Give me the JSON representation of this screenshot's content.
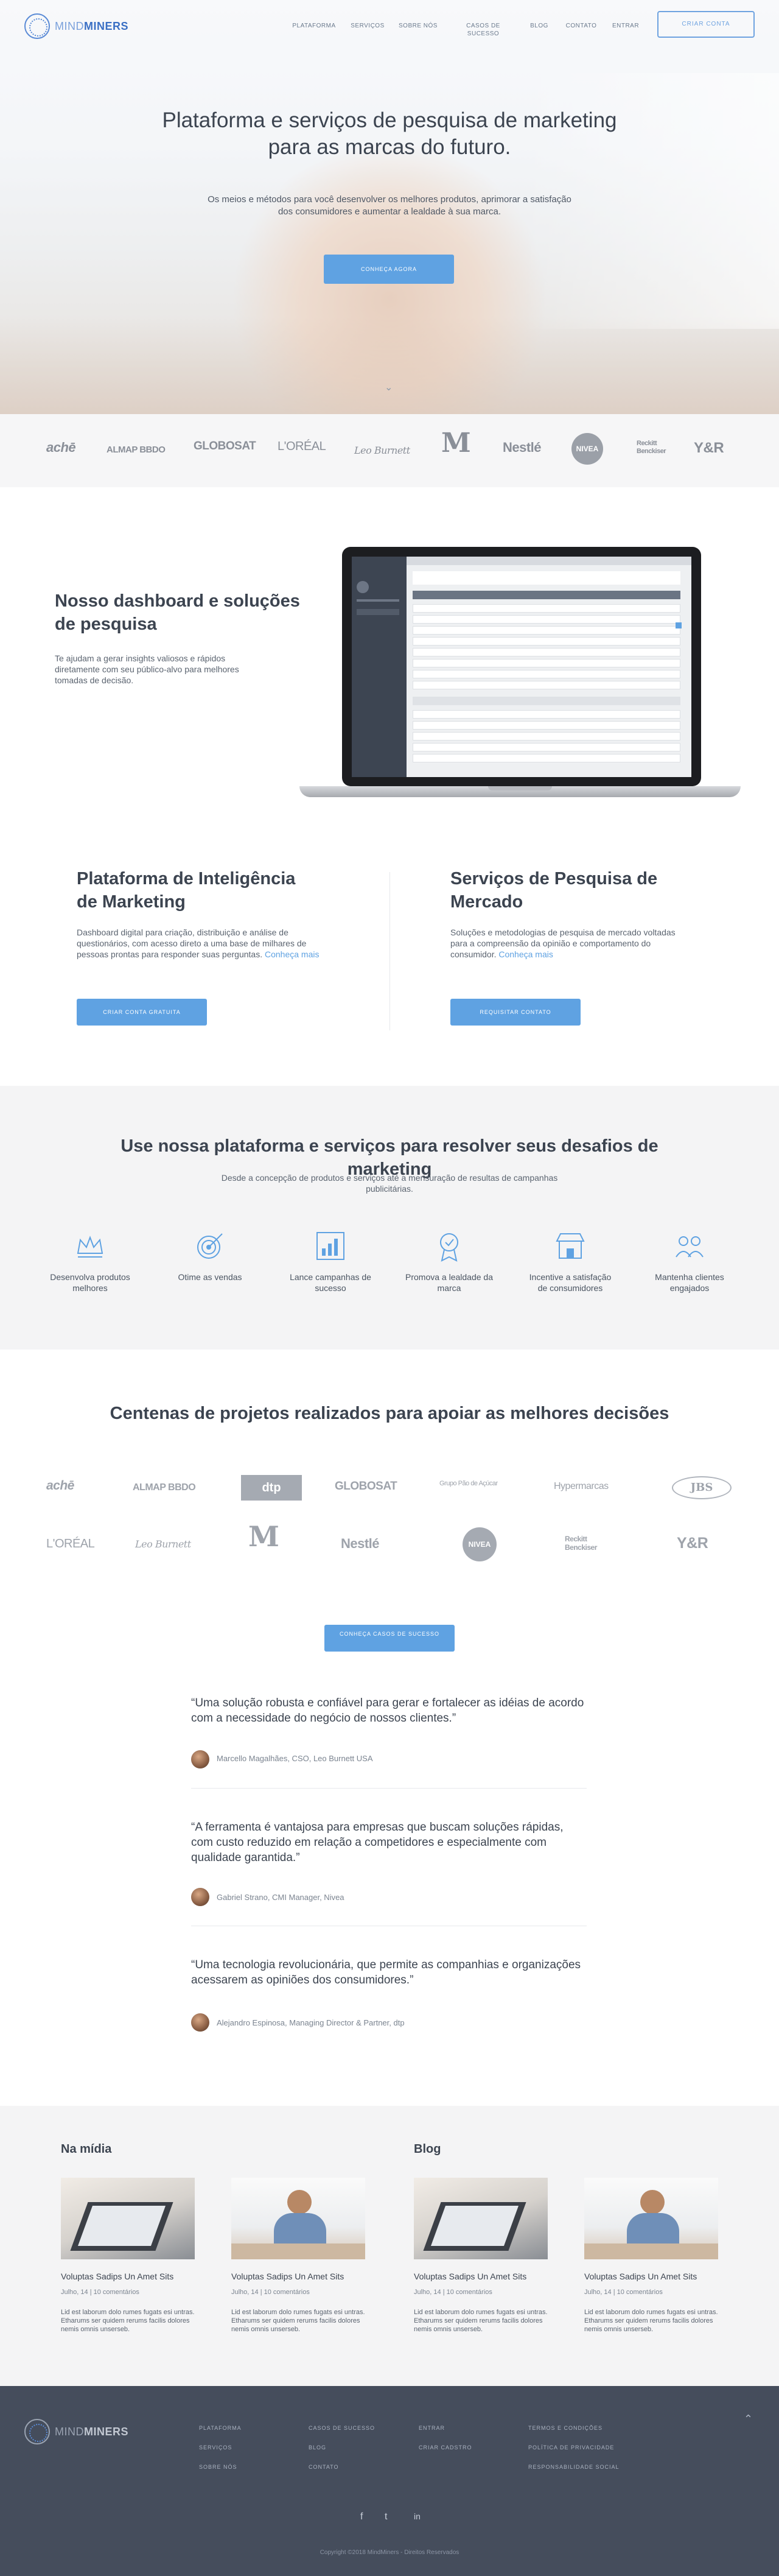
{
  "nav": {
    "logo_light": "MIND",
    "logo_bold": "MINERS",
    "items": [
      "PLATAFORMA",
      "SERVIÇOS",
      "SOBRE NÓS",
      "CASOS DE SUCESSO",
      "BLOG",
      "CONTATO",
      "ENTRAR"
    ],
    "cta": "CRIAR CONTA"
  },
  "hero": {
    "title": "Plataforma e serviços de pesquisa de marketing para as marcas do futuro.",
    "subtitle": "Os meios e métodos para você desenvolver os melhores produtos, aprimorar a satisfação dos consumidores e aumentar a lealdade à sua marca.",
    "button": "CONHEÇA AGORA"
  },
  "brands": [
    "achē",
    "ALMAP BBDO",
    "GLOBOSAT",
    "L'ORÉAL",
    "Leo Burnett",
    "M",
    "Nestlé",
    "NIVEA",
    "Reckitt Benckiser",
    "Y&R"
  ],
  "dashboard": {
    "title": "Nosso dashboard e soluções de pesquisa",
    "subtitle": "Te ajudam a gerar insights valiosos e rápidos diretamente com seu público-alvo para melhores tomadas de decisão."
  },
  "platform": {
    "title": "Plataforma de Inteligência de Marketing",
    "text": "Dashboard digital para criação, distribuição e análise de questionários, com acesso direto a uma base de milhares de pessoas prontas para responder suas perguntas.",
    "link": "Conheça mais",
    "button": "CRIAR CONTA GRATUITA"
  },
  "services": {
    "title": "Serviços de Pesquisa de Mercado",
    "text": "Soluções e metodologias de pesquisa de mercado voltadas para a compreensão da opinião e comportamento do consumidor.",
    "link": "Conheça mais",
    "button": "REQUISITAR CONTATO"
  },
  "features": {
    "title": "Use nossa plataforma e serviços para resolver seus desafios de marketing",
    "subtitle": "Desde a concepção de produtos e serviços até a mensuração de resultas de campanhas publicitárias.",
    "items": [
      {
        "label": "Desenvolva produtos melhores",
        "icon": "crown-icon"
      },
      {
        "label": "Otime as vendas",
        "icon": "target-icon"
      },
      {
        "label": "Lance campanhas de sucesso",
        "icon": "chart-icon"
      },
      {
        "label": "Promova a lealdade da marca",
        "icon": "badge-icon"
      },
      {
        "label": "Incentive a satisfação de consumidores",
        "icon": "store-icon"
      },
      {
        "label": "Mantenha clientes engajados",
        "icon": "people-icon"
      }
    ]
  },
  "projects": {
    "title": "Centenas de projetos realizados para apoiar as melhores decisões",
    "row1": [
      "achē",
      "ALMAP BBDO",
      "dtp",
      "GLOBOSAT",
      "Grupo Pão de Açúcar",
      "Hypermarcas",
      "JBS"
    ],
    "row2": [
      "L'ORÉAL",
      "Leo Burnett",
      "M",
      "Nestlé",
      "NIVEA",
      "Reckitt Benckiser",
      "Y&R"
    ],
    "button": "CONHEÇA CASOS DE SUCESSO"
  },
  "testimonials": [
    {
      "quote": "“Uma solução robusta e confiável para gerar e fortalecer as idéias de acordo com a necessidade do negócio de nossos clientes.”",
      "author": "Marcello Magalhães, CSO, Leo Burnett USA"
    },
    {
      "quote": "“A ferramenta é vantajosa para empresas que buscam soluções rápidas, com custo reduzido em relação a competidores e especialmente com qualidade garantida.”",
      "author": "Gabriel Strano, CMI Manager, Nivea"
    },
    {
      "quote": "“Uma tecnologia revolucionária, que permite as companhias e organizações acessarem as opiniões dos consumidores.”",
      "author": "Alejandro Espinosa, Managing Director & Partner, dtp"
    }
  ],
  "news": {
    "media_title": "Na mídia",
    "blog_title": "Blog",
    "cards": [
      {
        "title": "Voluptas Sadips Un Amet Sits",
        "meta": "Julho, 14 | 10 comentários",
        "text": "Lid est laborum dolo rumes fugats esi untras. Etharums ser quidem rerums facilis dolores nemis omnis unserseb."
      },
      {
        "title": "Voluptas Sadips Un Amet Sits",
        "meta": "Julho, 14 | 10 comentários",
        "text": "Lid est laborum dolo rumes fugats esi untras. Etharums ser quidem rerums facilis dolores nemis omnis unserseb."
      },
      {
        "title": "Voluptas Sadips Un Amet Sits",
        "meta": "Julho, 14 | 10 comentários",
        "text": "Lid est laborum dolo rumes fugats esi untras. Etharums ser quidem rerums facilis dolores nemis omnis unserseb."
      },
      {
        "title": "Voluptas Sadips Un Amet Sits",
        "meta": "Julho, 14 | 10 comentários",
        "text": "Lid est laborum dolo rumes fugats esi untras. Etharums ser quidem rerums facilis dolores nemis omnis unserseb."
      }
    ]
  },
  "footer": {
    "col1": [
      "PLATAFORMA",
      "SERVIÇOS",
      "SOBRE NÓS"
    ],
    "col2": [
      "CASOS DE SUCESSO",
      "BLOG",
      "CONTATO"
    ],
    "col3": [
      "ENTRAR",
      "CRIAR CADSTRO"
    ],
    "col4": [
      "TERMOS E CONDIÇÕES",
      "POLÍTICA DE PRIVACIDADE",
      "RESPONSABILIDADE SOCIAL"
    ],
    "social": [
      "f",
      "t",
      "in"
    ],
    "copyright": "Copyright ©2018 MindMiners - Direitos Reservados"
  },
  "colors": {
    "accent": "#5fa2e2",
    "dark": "#454d5c",
    "text": "#3c4450"
  }
}
